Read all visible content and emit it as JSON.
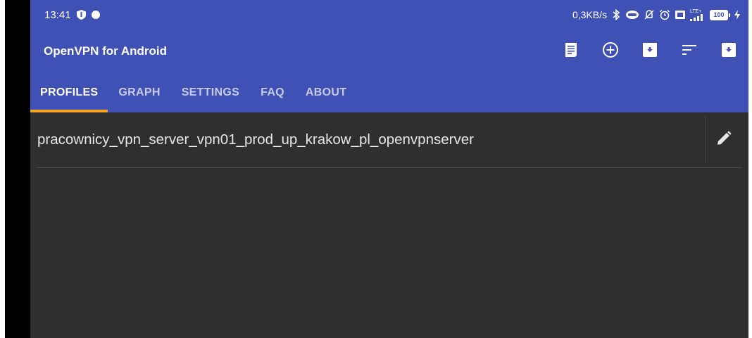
{
  "status_bar": {
    "time": "13:41",
    "net_speed": "0,3KB/s",
    "network_type": "LTE+",
    "battery": "100",
    "icons": [
      "shield-icon",
      "dot-icon",
      "bluetooth-icon",
      "vpn-key-icon",
      "mute-icon",
      "alarm-icon",
      "sim-icon",
      "signal-icon",
      "battery-icon",
      "charging-icon"
    ]
  },
  "toolbar": {
    "title": "OpenVPN for Android",
    "actions": [
      "log-icon",
      "add-profile-icon",
      "import-icon",
      "sort-icon",
      "archive-icon"
    ]
  },
  "tabs": [
    {
      "label": "PROFILES",
      "active": true
    },
    {
      "label": "GRAPH",
      "active": false
    },
    {
      "label": "SETTINGS",
      "active": false
    },
    {
      "label": "FAQ",
      "active": false
    },
    {
      "label": "ABOUT",
      "active": false
    }
  ],
  "profiles": [
    {
      "name": "pracownicy_vpn_server_vpn01_prod_up_krakow_pl_openvpnserver"
    }
  ],
  "colors": {
    "primary": "#3f51b5",
    "accent": "#f5a623",
    "background": "#2f2f2f"
  }
}
